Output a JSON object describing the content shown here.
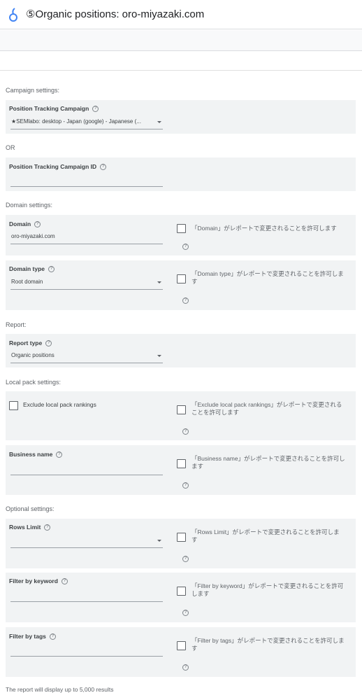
{
  "header": {
    "title": "⑤Organic positions: oro-miyazaki.com"
  },
  "colors": {
    "card_bg": "#f1f3f4",
    "logo_blue": "#4285f4"
  },
  "sections": {
    "campaign": "Campaign settings:",
    "or": "OR",
    "domain": "Domain settings:",
    "report": "Report:",
    "local_pack": "Local pack settings:",
    "optional": "Optional settings:"
  },
  "fields": {
    "campaign": {
      "label": "Position Tracking Campaign",
      "value": "★SEMlabo: desktop - Japan (google) - Japanese (..."
    },
    "campaign_id": {
      "label": "Position Tracking Campaign ID",
      "value": ""
    },
    "domain": {
      "label": "Domain",
      "value": "oro-miyazaki.com",
      "allow": "「Domain」がレポートで変更されることを許可します"
    },
    "domain_type": {
      "label": "Domain type",
      "value": "Root domain",
      "allow": "「Domain type」がレポートで変更されることを許可します"
    },
    "report_type": {
      "label": "Report type",
      "value": "Organic positions"
    },
    "exclude_local": {
      "label": "Exclude local pack rankings",
      "allow": "「Exclude local pack rankings」がレポートで変更されることを許可します"
    },
    "business_name": {
      "label": "Business name",
      "value": "",
      "allow": "「Business name」がレポートで変更されることを許可します"
    },
    "rows_limit": {
      "label": "Rows Limit",
      "value": "",
      "allow": "「Rows Limit」がレポートで変更されることを許可します"
    },
    "filter_keyword": {
      "label": "Filter by keyword",
      "value": "",
      "allow": "「Filter by keyword」がレポートで変更されることを許可します"
    },
    "filter_tags": {
      "label": "Filter by tags",
      "value": "",
      "allow": "「Filter by tags」がレポートで変更されることを許可します"
    }
  },
  "footer_note": "The report will display up to 5,000 results"
}
